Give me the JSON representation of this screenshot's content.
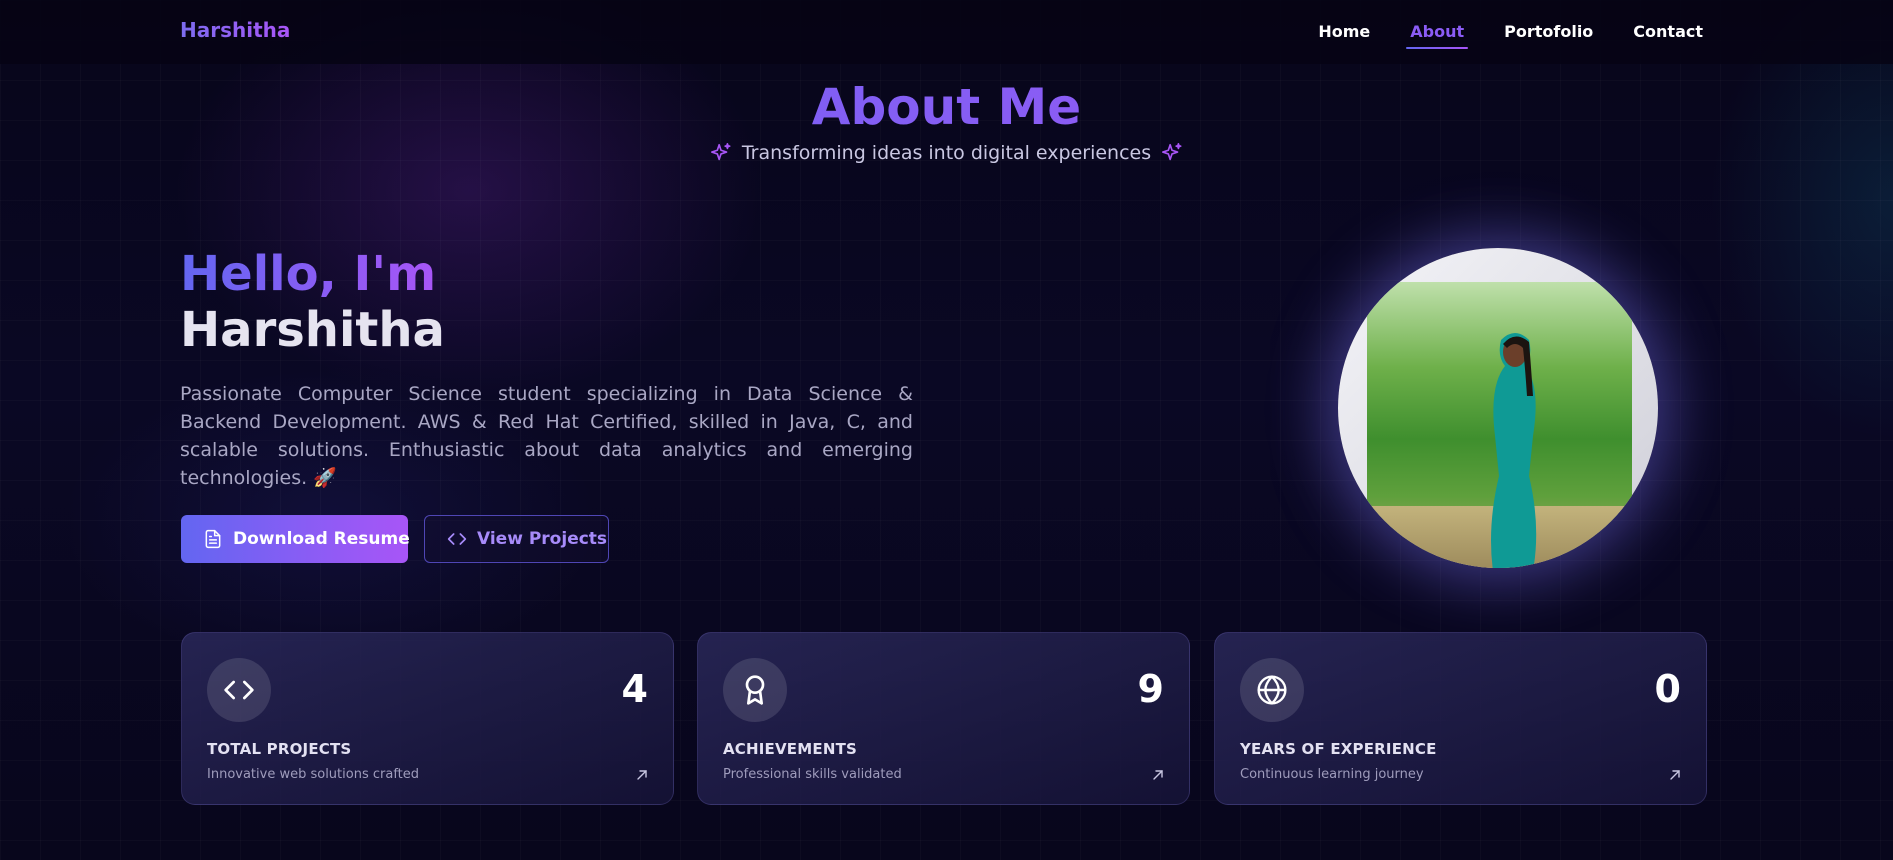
{
  "brand": {
    "name": "Harshitha"
  },
  "nav": {
    "items": [
      {
        "label": "Home"
      },
      {
        "label": "About",
        "active": true
      },
      {
        "label": "Portofolio"
      },
      {
        "label": "Contact"
      }
    ]
  },
  "header": {
    "title": "About Me",
    "subtitle": "Transforming ideas into digital experiences",
    "sparkle_icon": "sparkles-icon"
  },
  "intro": {
    "greeting": "Hello, I'm",
    "name": "Harshitha",
    "bio": "Passionate Computer Science student specializing in Data Science & Backend Development. AWS & Red Hat Certified, skilled in Java, C, and scalable solutions. Enthusiastic about data analytics and emerging technologies. 🚀"
  },
  "buttons": {
    "download_label": "Download Resume",
    "download_icon": "file-text-icon",
    "projects_label": "View Projects",
    "projects_icon": "code-icon"
  },
  "stats": [
    {
      "icon": "code-icon",
      "value": "4",
      "label": "TOTAL PROJECTS",
      "description": "Innovative web solutions crafted"
    },
    {
      "icon": "award-icon",
      "value": "9",
      "label": "ACHIEVEMENTS",
      "description": "Professional skills validated"
    },
    {
      "icon": "globe-icon",
      "value": "0",
      "label": "YEARS OF EXPERIENCE",
      "description": "Continuous learning journey"
    }
  ],
  "colors": {
    "accent_start": "#6366f1",
    "accent_end": "#a855f7",
    "background": "#070516"
  }
}
